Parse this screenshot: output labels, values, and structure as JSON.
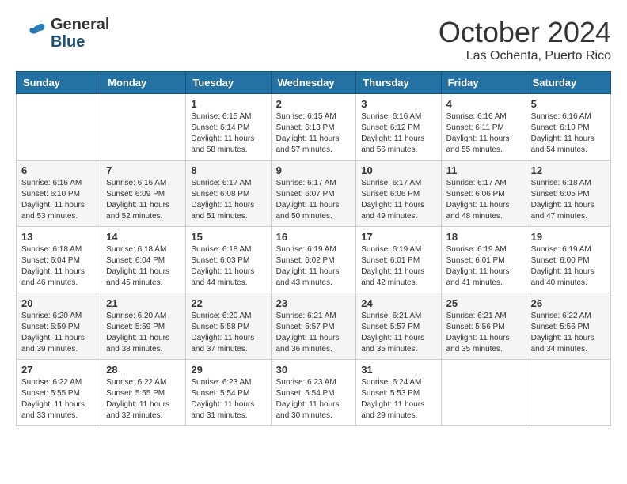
{
  "header": {
    "logo_general": "General",
    "logo_blue": "Blue",
    "month": "October 2024",
    "location": "Las Ochenta, Puerto Rico"
  },
  "weekdays": [
    "Sunday",
    "Monday",
    "Tuesday",
    "Wednesday",
    "Thursday",
    "Friday",
    "Saturday"
  ],
  "weeks": [
    [
      {
        "day": "",
        "info": ""
      },
      {
        "day": "",
        "info": ""
      },
      {
        "day": "1",
        "info": "Sunrise: 6:15 AM\nSunset: 6:14 PM\nDaylight: 11 hours and 58 minutes."
      },
      {
        "day": "2",
        "info": "Sunrise: 6:15 AM\nSunset: 6:13 PM\nDaylight: 11 hours and 57 minutes."
      },
      {
        "day": "3",
        "info": "Sunrise: 6:16 AM\nSunset: 6:12 PM\nDaylight: 11 hours and 56 minutes."
      },
      {
        "day": "4",
        "info": "Sunrise: 6:16 AM\nSunset: 6:11 PM\nDaylight: 11 hours and 55 minutes."
      },
      {
        "day": "5",
        "info": "Sunrise: 6:16 AM\nSunset: 6:10 PM\nDaylight: 11 hours and 54 minutes."
      }
    ],
    [
      {
        "day": "6",
        "info": "Sunrise: 6:16 AM\nSunset: 6:10 PM\nDaylight: 11 hours and 53 minutes."
      },
      {
        "day": "7",
        "info": "Sunrise: 6:16 AM\nSunset: 6:09 PM\nDaylight: 11 hours and 52 minutes."
      },
      {
        "day": "8",
        "info": "Sunrise: 6:17 AM\nSunset: 6:08 PM\nDaylight: 11 hours and 51 minutes."
      },
      {
        "day": "9",
        "info": "Sunrise: 6:17 AM\nSunset: 6:07 PM\nDaylight: 11 hours and 50 minutes."
      },
      {
        "day": "10",
        "info": "Sunrise: 6:17 AM\nSunset: 6:06 PM\nDaylight: 11 hours and 49 minutes."
      },
      {
        "day": "11",
        "info": "Sunrise: 6:17 AM\nSunset: 6:06 PM\nDaylight: 11 hours and 48 minutes."
      },
      {
        "day": "12",
        "info": "Sunrise: 6:18 AM\nSunset: 6:05 PM\nDaylight: 11 hours and 47 minutes."
      }
    ],
    [
      {
        "day": "13",
        "info": "Sunrise: 6:18 AM\nSunset: 6:04 PM\nDaylight: 11 hours and 46 minutes."
      },
      {
        "day": "14",
        "info": "Sunrise: 6:18 AM\nSunset: 6:04 PM\nDaylight: 11 hours and 45 minutes."
      },
      {
        "day": "15",
        "info": "Sunrise: 6:18 AM\nSunset: 6:03 PM\nDaylight: 11 hours and 44 minutes."
      },
      {
        "day": "16",
        "info": "Sunrise: 6:19 AM\nSunset: 6:02 PM\nDaylight: 11 hours and 43 minutes."
      },
      {
        "day": "17",
        "info": "Sunrise: 6:19 AM\nSunset: 6:01 PM\nDaylight: 11 hours and 42 minutes."
      },
      {
        "day": "18",
        "info": "Sunrise: 6:19 AM\nSunset: 6:01 PM\nDaylight: 11 hours and 41 minutes."
      },
      {
        "day": "19",
        "info": "Sunrise: 6:19 AM\nSunset: 6:00 PM\nDaylight: 11 hours and 40 minutes."
      }
    ],
    [
      {
        "day": "20",
        "info": "Sunrise: 6:20 AM\nSunset: 5:59 PM\nDaylight: 11 hours and 39 minutes."
      },
      {
        "day": "21",
        "info": "Sunrise: 6:20 AM\nSunset: 5:59 PM\nDaylight: 11 hours and 38 minutes."
      },
      {
        "day": "22",
        "info": "Sunrise: 6:20 AM\nSunset: 5:58 PM\nDaylight: 11 hours and 37 minutes."
      },
      {
        "day": "23",
        "info": "Sunrise: 6:21 AM\nSunset: 5:57 PM\nDaylight: 11 hours and 36 minutes."
      },
      {
        "day": "24",
        "info": "Sunrise: 6:21 AM\nSunset: 5:57 PM\nDaylight: 11 hours and 35 minutes."
      },
      {
        "day": "25",
        "info": "Sunrise: 6:21 AM\nSunset: 5:56 PM\nDaylight: 11 hours and 35 minutes."
      },
      {
        "day": "26",
        "info": "Sunrise: 6:22 AM\nSunset: 5:56 PM\nDaylight: 11 hours and 34 minutes."
      }
    ],
    [
      {
        "day": "27",
        "info": "Sunrise: 6:22 AM\nSunset: 5:55 PM\nDaylight: 11 hours and 33 minutes."
      },
      {
        "day": "28",
        "info": "Sunrise: 6:22 AM\nSunset: 5:55 PM\nDaylight: 11 hours and 32 minutes."
      },
      {
        "day": "29",
        "info": "Sunrise: 6:23 AM\nSunset: 5:54 PM\nDaylight: 11 hours and 31 minutes."
      },
      {
        "day": "30",
        "info": "Sunrise: 6:23 AM\nSunset: 5:54 PM\nDaylight: 11 hours and 30 minutes."
      },
      {
        "day": "31",
        "info": "Sunrise: 6:24 AM\nSunset: 5:53 PM\nDaylight: 11 hours and 29 minutes."
      },
      {
        "day": "",
        "info": ""
      },
      {
        "day": "",
        "info": ""
      }
    ]
  ]
}
